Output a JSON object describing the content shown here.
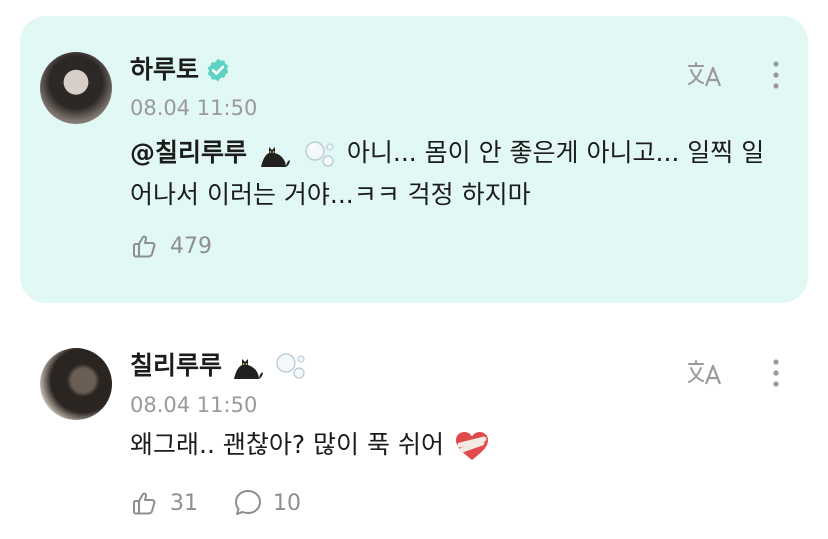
{
  "colors": {
    "card_bg": "#e1f8f4",
    "verified": "#5ed3c4",
    "muted": "#9a9a9a"
  },
  "comments": [
    {
      "author": "하루토",
      "verified": true,
      "time": "08.04 11:50",
      "mention": "@칠리루루",
      "text": "아니... 몸이 안 좋은게 아니고... 일찍 일어나서 이러는 거야...ㅋㅋ 걱정 하지마",
      "likes": "479"
    },
    {
      "author": "칠리루루",
      "verified": false,
      "time": "08.04 11:50",
      "text": "왜그래.. 괜찮아? 많이 푹 쉬어",
      "likes": "31",
      "replies": "10"
    }
  ],
  "icons": {
    "translate": "translate-icon",
    "more": "more-vertical-icon",
    "like": "like-icon",
    "reply": "reply-icon",
    "cat": "black-cat-emoji",
    "bubbles": "bubbles-emoji",
    "heart": "mending-heart-emoji"
  }
}
